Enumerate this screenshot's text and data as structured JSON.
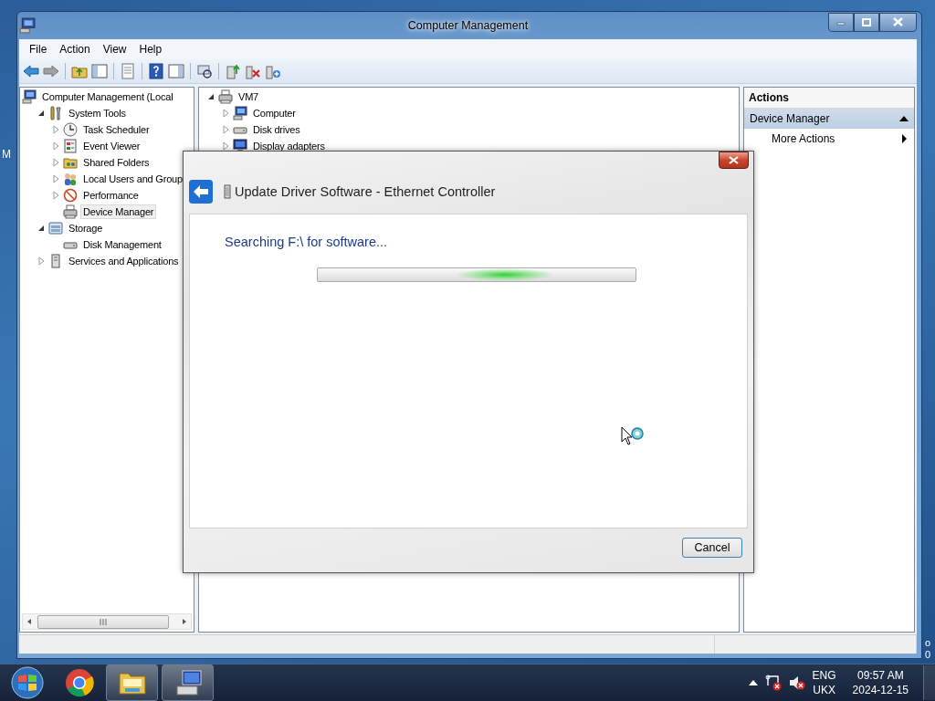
{
  "desktop": {
    "left_labels": [
      "M"
    ],
    "right_labels": [
      "o",
      "0"
    ]
  },
  "window": {
    "title": "Computer Management",
    "menu": [
      "File",
      "Action",
      "View",
      "Help"
    ]
  },
  "console_tree": {
    "items": [
      {
        "label": "Computer Management (Local",
        "kind": "computer",
        "selected": false,
        "children": [
          {
            "label": "System Tools",
            "kind": "tools",
            "expanded": true,
            "selected": false,
            "children": [
              {
                "label": "Task Scheduler",
                "kind": "clock",
                "expanded": false,
                "selected": false
              },
              {
                "label": "Event Viewer",
                "kind": "log",
                "expanded": false,
                "selected": false
              },
              {
                "label": "Shared Folders",
                "kind": "share",
                "expanded": false,
                "selected": false
              },
              {
                "label": "Local Users and Group",
                "kind": "users",
                "expanded": false,
                "selected": false
              },
              {
                "label": "Performance",
                "kind": "perf",
                "expanded": false,
                "selected": false
              },
              {
                "label": "Device Manager",
                "kind": "devices",
                "selected": true
              }
            ]
          },
          {
            "label": "Storage",
            "kind": "storage",
            "expanded": true,
            "selected": false,
            "children": [
              {
                "label": "Disk Management",
                "kind": "disk",
                "selected": false
              }
            ]
          },
          {
            "label": "Services and Applications",
            "kind": "services",
            "expanded": false,
            "selected": false
          }
        ]
      }
    ]
  },
  "device_tree": {
    "items": [
      {
        "label": "VM7",
        "kind": "devices",
        "expanded": true,
        "selected": false,
        "children": [
          {
            "label": "Computer",
            "kind": "computer",
            "expanded": false,
            "selected": false
          },
          {
            "label": "Disk drives",
            "kind": "disk",
            "expanded": false,
            "selected": false
          },
          {
            "label": "Display adapters",
            "kind": "monitor",
            "expanded": false,
            "selected": false
          }
        ]
      }
    ]
  },
  "actions": {
    "title": "Actions",
    "sections": [
      {
        "label": "Device Manager",
        "expanded": true,
        "items": [
          {
            "label": "More Actions",
            "submenu": true
          }
        ]
      }
    ]
  },
  "dialog": {
    "title": "Update Driver Software - Ethernet Controller",
    "status": "Searching F:\\ for software...",
    "progress": {
      "kind": "marquee"
    },
    "buttons": [
      "Cancel"
    ]
  },
  "taskbar": {
    "buttons": [
      {
        "kind": "chrome",
        "running": false
      },
      {
        "kind": "explorer",
        "running": true
      },
      {
        "kind": "computer-management",
        "running": true
      }
    ],
    "tray": {
      "language": [
        "ENG",
        "UKX"
      ],
      "time": "09:57 AM",
      "date": "2024-12-15"
    }
  }
}
